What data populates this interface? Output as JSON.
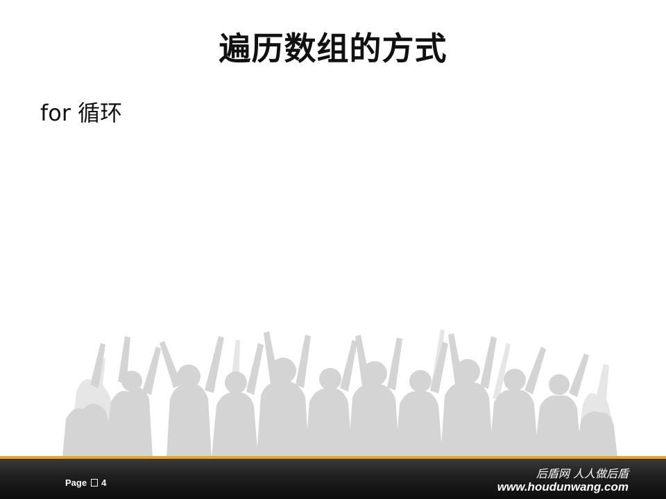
{
  "slide": {
    "title": "遍历数组的方式",
    "body_text": "for  循环"
  },
  "footer": {
    "page_label": "Page",
    "page_number": "4",
    "slogan": "后盾网 人人做后盾",
    "url": "www.houdunwang.com"
  },
  "colors": {
    "accent_gold": "#e8a81a",
    "footer_dark": "#1a1a1a",
    "crowd_gray": "#d6d6d6"
  }
}
